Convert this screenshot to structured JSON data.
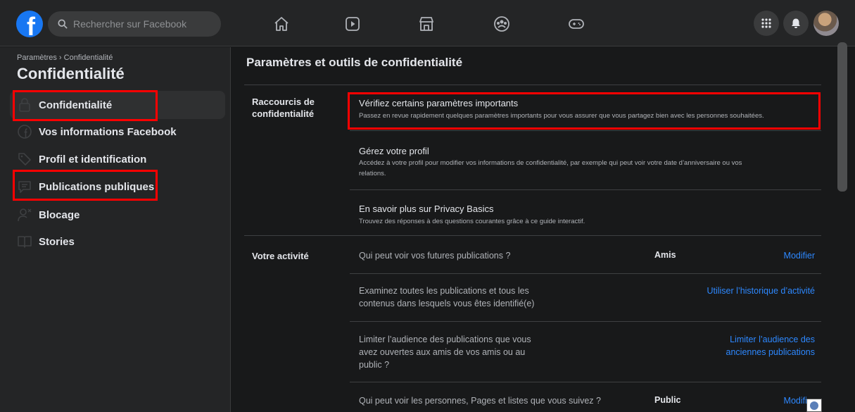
{
  "header": {
    "logo": "f",
    "search_placeholder": "Rechercher sur Facebook",
    "nav_icons": [
      "home-icon",
      "watch-icon",
      "marketplace-icon",
      "groups-icon",
      "gaming-icon"
    ],
    "right_icons": [
      "menu-grid-icon",
      "notifications-icon",
      "avatar"
    ]
  },
  "sidebar": {
    "breadcrumb": "Paramètres › Confidentialité",
    "title": "Confidentialité",
    "items": [
      {
        "label": "Confidentialité",
        "icon": "lock-icon",
        "active": true
      },
      {
        "label": "Vos informations Facebook",
        "icon": "facebook-circle-icon"
      },
      {
        "label": "Profil et identification",
        "icon": "tag-icon"
      },
      {
        "label": "Publications publiques",
        "icon": "public-posts-icon"
      },
      {
        "label": "Blocage",
        "icon": "block-user-icon"
      },
      {
        "label": "Stories",
        "icon": "book-icon"
      }
    ]
  },
  "main": {
    "title": "Paramètres et outils de confidentialité",
    "shortcuts": {
      "label_line1": "Raccourcis de",
      "label_line2": "confidentialité",
      "items": [
        {
          "title": "Vérifiez certains paramètres importants",
          "desc": "Passez en revue rapidement quelques paramètres importants pour vous assurer que vous partagez bien avec les personnes souhaitées."
        },
        {
          "title": "Gérez votre profil",
          "desc_line1": "Accédez à votre profil pour modifier vos informations de confidentialité, par exemple qui peut voir votre date d’anniversaire ou vos",
          "desc_line2": "relations."
        },
        {
          "title": "En savoir plus sur Privacy Basics",
          "desc": "Trouvez des réponses à des questions courantes grâce à ce guide interactif."
        }
      ]
    },
    "activity": {
      "label": "Votre activité",
      "rows": [
        {
          "text": "Qui peut voir vos futures publications ?",
          "value": "Amis",
          "link": "Modifier"
        },
        {
          "text_line1": "Examinez toutes les publications et tous les",
          "text_line2": "contenus dans lesquels vous êtes identifié(e)",
          "link": "Utiliser l’historique d’activité"
        },
        {
          "text_line1": "Limiter l’audience des publications que vous",
          "text_line2": "avez ouvertes aux amis de vos amis ou au",
          "text_line3": "public ?",
          "link_line1": "Limiter l’audience des",
          "link_line2": "anciennes publications"
        },
        {
          "text": "Qui peut voir les personnes, Pages et listes que vous suivez ?",
          "value": "Public",
          "link": "Modifier"
        }
      ]
    }
  }
}
